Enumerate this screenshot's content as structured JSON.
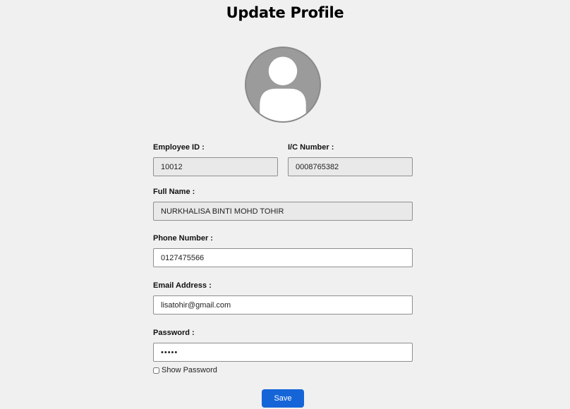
{
  "page": {
    "title": "Update Profile"
  },
  "avatar": {
    "icon": "user-silhouette-icon"
  },
  "form": {
    "employee_id": {
      "label": "Employee ID :",
      "value": "10012"
    },
    "ic_number": {
      "label": "I/C Number :",
      "value": "0008765382"
    },
    "full_name": {
      "label": "Full Name :",
      "value": "NURKHALISA BINTI MOHD TOHIR"
    },
    "phone": {
      "label": "Phone Number :",
      "value": "0127475566"
    },
    "email": {
      "label": "Email Address :",
      "value": "lisatohir@gmail.com"
    },
    "password": {
      "label": "Password :",
      "value": "•••••"
    },
    "show_password": {
      "label": "Show Password",
      "checked": false
    },
    "save_label": "Save"
  },
  "colors": {
    "background": "#f0f0f0",
    "readonly_field": "#e9e9e9",
    "button": "#1565d8",
    "avatar": "#9b9b9b"
  }
}
